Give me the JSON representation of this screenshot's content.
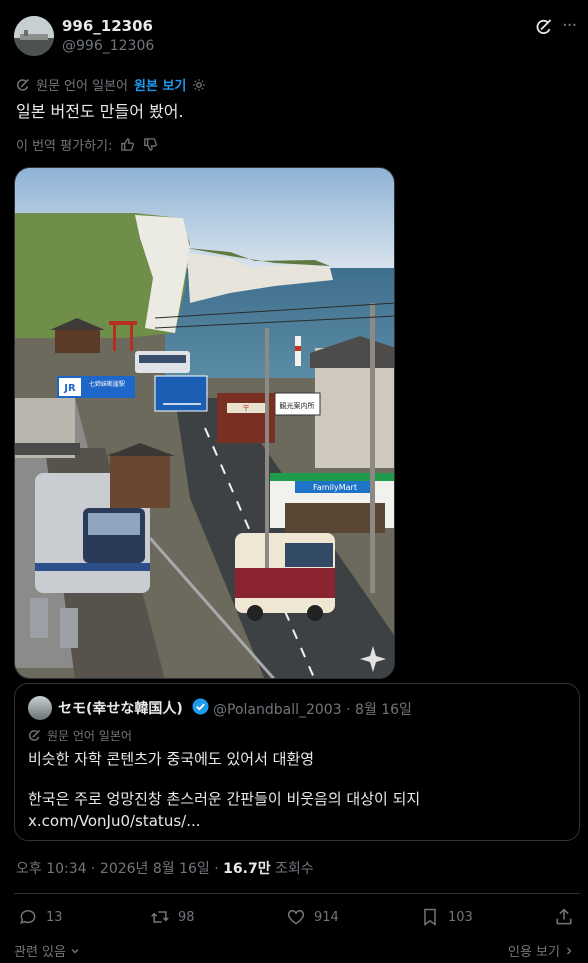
{
  "author": {
    "name": "996_12306",
    "handle": "@996_12306"
  },
  "translation": {
    "prefix": "원문 언어 일본어",
    "show_original": "원본 보기"
  },
  "post_text": "일본 버전도 만들어 봤어.",
  "rate": {
    "label": "이 번역 평가하기:"
  },
  "image": {
    "signs": {
      "jr": "JR",
      "station_cn": "七姉妹断崖駅",
      "station_en": "Seven sister's cliff Station",
      "tourist": "観光案内所",
      "familymart": "FamilyMart",
      "post": "〒"
    }
  },
  "quote": {
    "name": "セモ(幸せな韓国人)",
    "handle": "@Polandball_2003",
    "date": "8월 16일",
    "translate_label": "원문 언어 일본어",
    "line1": "비슷한 자학 콘텐츠가 중국에도 있어서 대환영",
    "line2": "한국은 주로 엉망진창 촌스러운 간판들이 비웃음의 대상이 되지 x.com/VonJu0/status/..."
  },
  "meta": {
    "time": "오후 10:34 · 2026년 8월 16일 · ",
    "views": "16.7만",
    "views_label": " 조회수"
  },
  "actions": {
    "replies": "13",
    "reposts": "98",
    "likes": "914",
    "bookmarks": "103"
  },
  "footer": {
    "related": "관련 있음",
    "quotes": "인용 보기"
  },
  "colors": {
    "accent": "#1d9bf0",
    "secondary": "#71767b",
    "text": "#e7e9ea",
    "border": "#2f3336",
    "background": "#000000"
  }
}
